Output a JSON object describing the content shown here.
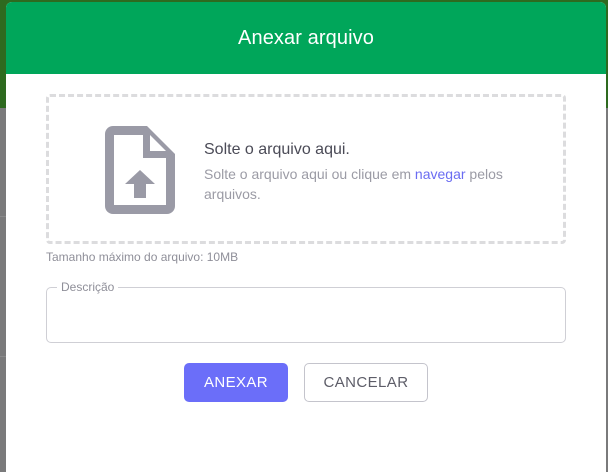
{
  "modal": {
    "title": "Anexar arquivo"
  },
  "dropzone": {
    "title": "Solte o arquivo aqui.",
    "subtitle_before": "Solte o arquivo aqui ou clique em ",
    "link_label": "navegar",
    "subtitle_after": " pelos arquivos.",
    "icon": "file-upload-icon"
  },
  "max_size_label": "Tamanho máximo do arquivo: 10MB",
  "description_field": {
    "legend": "Descrição",
    "value": ""
  },
  "buttons": {
    "attach_label": "ANEXAR",
    "cancel_label": "CANCELAR"
  },
  "colors": {
    "header": "#00a65a",
    "primary": "#6b6ef9",
    "link": "#6a6cf2"
  }
}
